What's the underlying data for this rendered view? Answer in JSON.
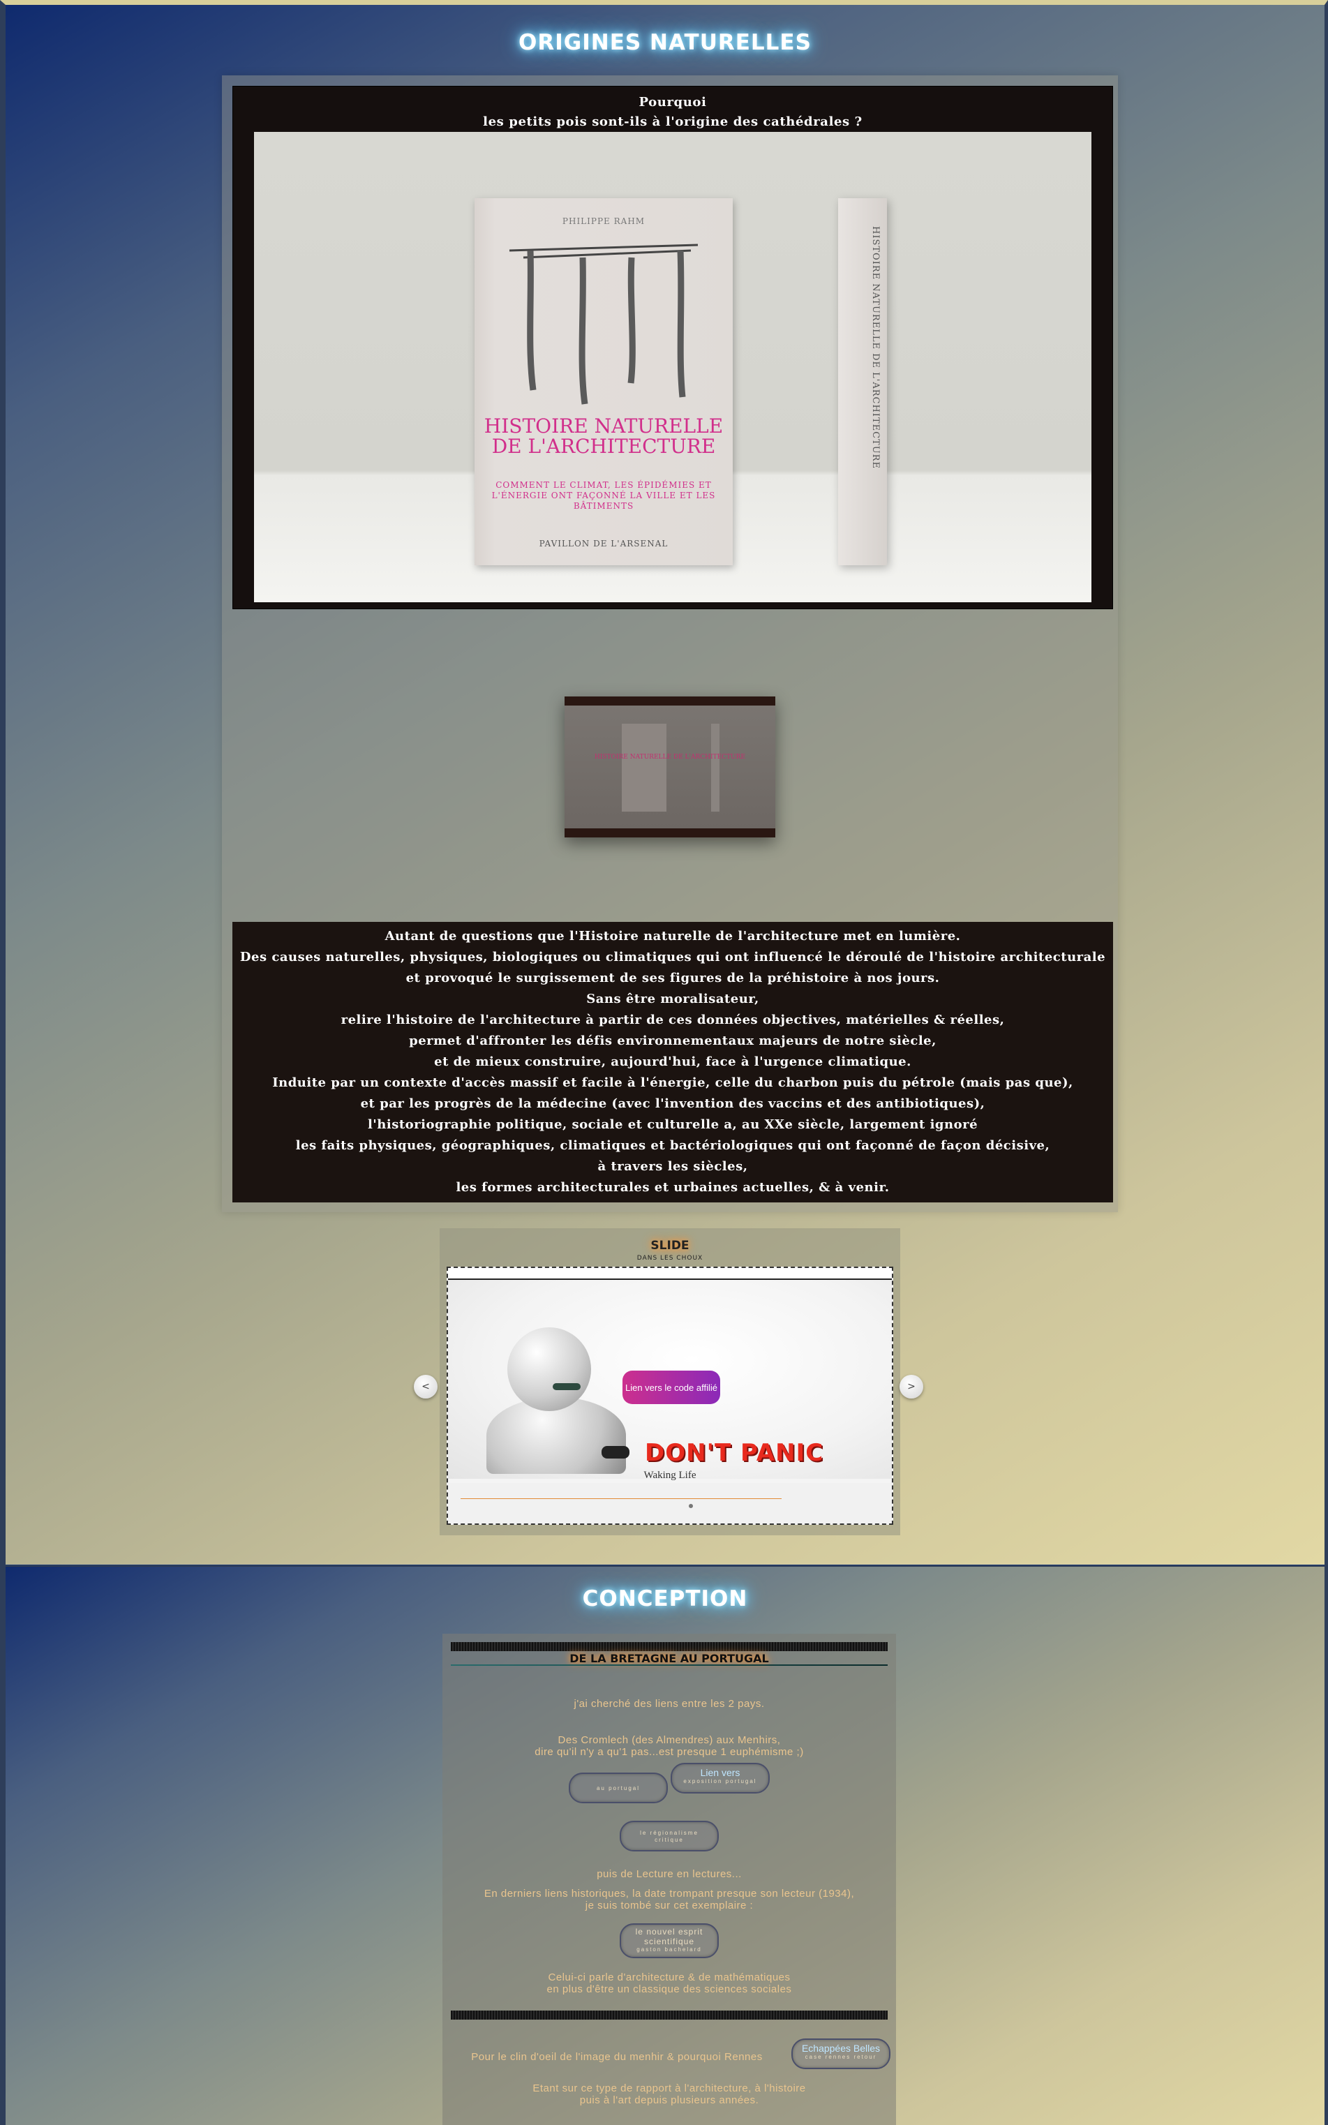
{
  "section1": {
    "title": "ORIGINES NATURELLES",
    "hero": {
      "question_line1": "Pourquoi",
      "question_line2": "les petits pois sont-ils à l'origine des cathédrales ?",
      "book_author": "PHILIPPE RAHM",
      "book_title": "HISTOIRE NATURELLE DE L'ARCHITECTURE",
      "book_subtitle": "COMMENT LE CLIMAT, LES ÉPIDÉMIES ET L'ÉNERGIE ONT FAÇONNÉ LA VILLE ET LES BÂTIMENTS",
      "book_publisher": "PAVILLON DE L'ARSENAL",
      "spine_text": "HISTOIRE NATURELLE DE L'ARCHITECTURE"
    },
    "thumbnail_title": "HISTOIRE NATURELLE DE L'ARCHITECTURE",
    "description_lines": [
      "Autant de questions que l'Histoire naturelle de l'architecture met en lumière.",
      "Des causes naturelles, physiques, biologiques ou climatiques qui ont influencé le déroulé de l'histoire architecturale",
      "et provoqué le surgissement de ses figures de la préhistoire à nos jours.",
      "Sans être moralisateur,",
      "relire l'histoire de l'architecture à partir de ces données objectives, matérielles & réelles,",
      "permet d'affronter les défis environnementaux majeurs de notre siècle,",
      "et de mieux construire, aujourd'hui, face à l'urgence climatique.",
      "Induite par un contexte d'accès massif et facile à l'énergie, celle du charbon puis du pétrole (mais pas que),",
      "et par les progrès de la médecine (avec l'invention des vaccins et des antibiotiques),",
      "l'historiographie politique, sociale et culturelle a, au XXe siècle, largement ignoré",
      "les faits physiques, géographiques, climatiques et bactériologiques qui ont façonné de façon décisive,",
      "à travers les siècles,",
      "les formes architecturales et urbaines actuelles, & à venir."
    ],
    "slider": {
      "title": "SLIDE",
      "subtitle": "DANS LES CHOUX",
      "affiliate_button": "Lien vers le code affilié",
      "panic_text": "DON'T PANIC",
      "caption": "Waking Life",
      "prev_label": "<",
      "next_label": ">"
    }
  },
  "section2": {
    "title": "CONCEPTION",
    "heading": "DE LA BRETAGNE AU PORTUGAL",
    "text1": "j'ai cherché des liens entre les 2 pays.",
    "text2_line1": "Des Cromlech (des Almendres) aux Menhirs,",
    "text2_line2": "dire qu'il n'y a qu'1 pas...est presque 1 euphémisme ;)",
    "pill_portugal": "au portugal",
    "pill_expo_main": "Lien vers",
    "pill_expo_small": "exposition portugal",
    "pill_region_line1": "le régionalisme",
    "pill_region_line2": "critique",
    "text3": "puis de Lecture en lectures...",
    "text4_line1": "En derniers liens historiques, la date trompant presque son lecteur (1934),",
    "text4_line2": "je suis tombé sur cet exemplaire :",
    "pill_esprit_line1": "le nouvel esprit",
    "pill_esprit_line2": "scientifique",
    "pill_esprit_small": "gaston bachelard",
    "text5_line1": "Celui-ci parle d'architecture & de mathématiques",
    "text5_line2": "en plus d'être un classique des sciences sociales",
    "text6": "Pour le clin d'oeil de l'image du menhir & pourquoi Rennes",
    "pill_echap_main": "Echappées Belles",
    "pill_echap_small": "case rennes retour",
    "text7_line1": "Etant sur ce type de rapport à l'architecture, à l'histoire",
    "text7_line2": "puis à l'art depuis plusieurs années."
  }
}
